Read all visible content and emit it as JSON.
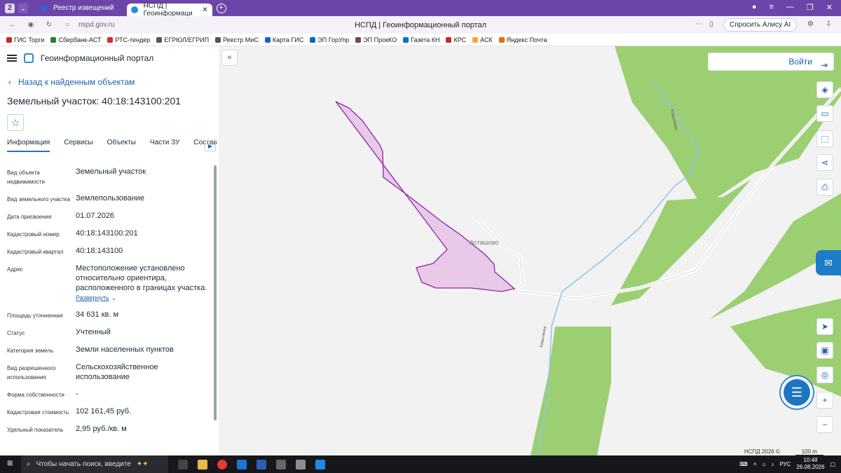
{
  "browser": {
    "tab_count": "2",
    "tabs": [
      {
        "label": "Реестр извещений"
      },
      {
        "label": "НСПД | Геоинформаци"
      }
    ],
    "url": "nspd.gov.ru",
    "page_title": "НСПД | Геоинформационный портал",
    "alice_label": "Спросить Алису AI"
  },
  "bookmarks": [
    "ГИС Торги",
    "Сбербанк-АСТ",
    "РТС-тендер",
    "ЕГРЮЛ/ЕГРИП",
    "Реестр МиС",
    "Карта ГИС",
    "ЭП ГорУпр",
    "ЭП ПрокКО",
    "Газета КН",
    "КРС",
    "АСК",
    "Яндекс Почта"
  ],
  "app": {
    "title": "Геоинформационный портал",
    "back_label": "Назад к найденным объектам",
    "object_title": "Земельный участок: 40:18:143100:201",
    "tabs": [
      "Информация",
      "Сервисы",
      "Объекты",
      "Части ЗУ",
      "Состав"
    ],
    "properties": [
      {
        "label": "Вид объекта недвижимости",
        "value": "Земельный участок"
      },
      {
        "label": "Вид земельного участка",
        "value": "Землепользование"
      },
      {
        "label": "Дата присвоения",
        "value": "01.07.2026"
      },
      {
        "label": "Кадастровый номер",
        "value": "40:18:143100:201"
      },
      {
        "label": "Кадастровый квартал",
        "value": "40:18:143100"
      },
      {
        "label": "Адрес",
        "value": "Местоположение установлено относительно ориентира, расположенного в границах участка."
      },
      {
        "label": "Площадь уточненная",
        "value": "34 631 кв. м"
      },
      {
        "label": "Статус",
        "value": "Учтенный"
      },
      {
        "label": "Категория земель",
        "value": "Земли населенных пунктов"
      },
      {
        "label": "Вид разрешенного использования",
        "value": "Сельскохозяйственное использование"
      },
      {
        "label": "Форма собственности",
        "value": "-"
      },
      {
        "label": "Кадастровая стоимость",
        "value": "102 161,45 руб."
      },
      {
        "label": "Удельный показатель",
        "value": "2,95 руб./кв. м"
      }
    ],
    "expand_label": "Развернуть"
  },
  "map": {
    "login_label": "Войти",
    "village_label": "Асташово",
    "stream_label_1": "Ковылинка",
    "stream_label_2": "Ковылинка",
    "attribution": "НСПД 2026 ©",
    "scale_label": "100 m",
    "parcel_fill": "#e8c9e8",
    "parcel_stroke": "#8e24aa",
    "forest_color": "#9ccf72"
  },
  "taskbar": {
    "search_placeholder": "Чтобы начать поиск, введите",
    "lang": "РУС",
    "time": "10:48",
    "date": "26.08.2026"
  }
}
